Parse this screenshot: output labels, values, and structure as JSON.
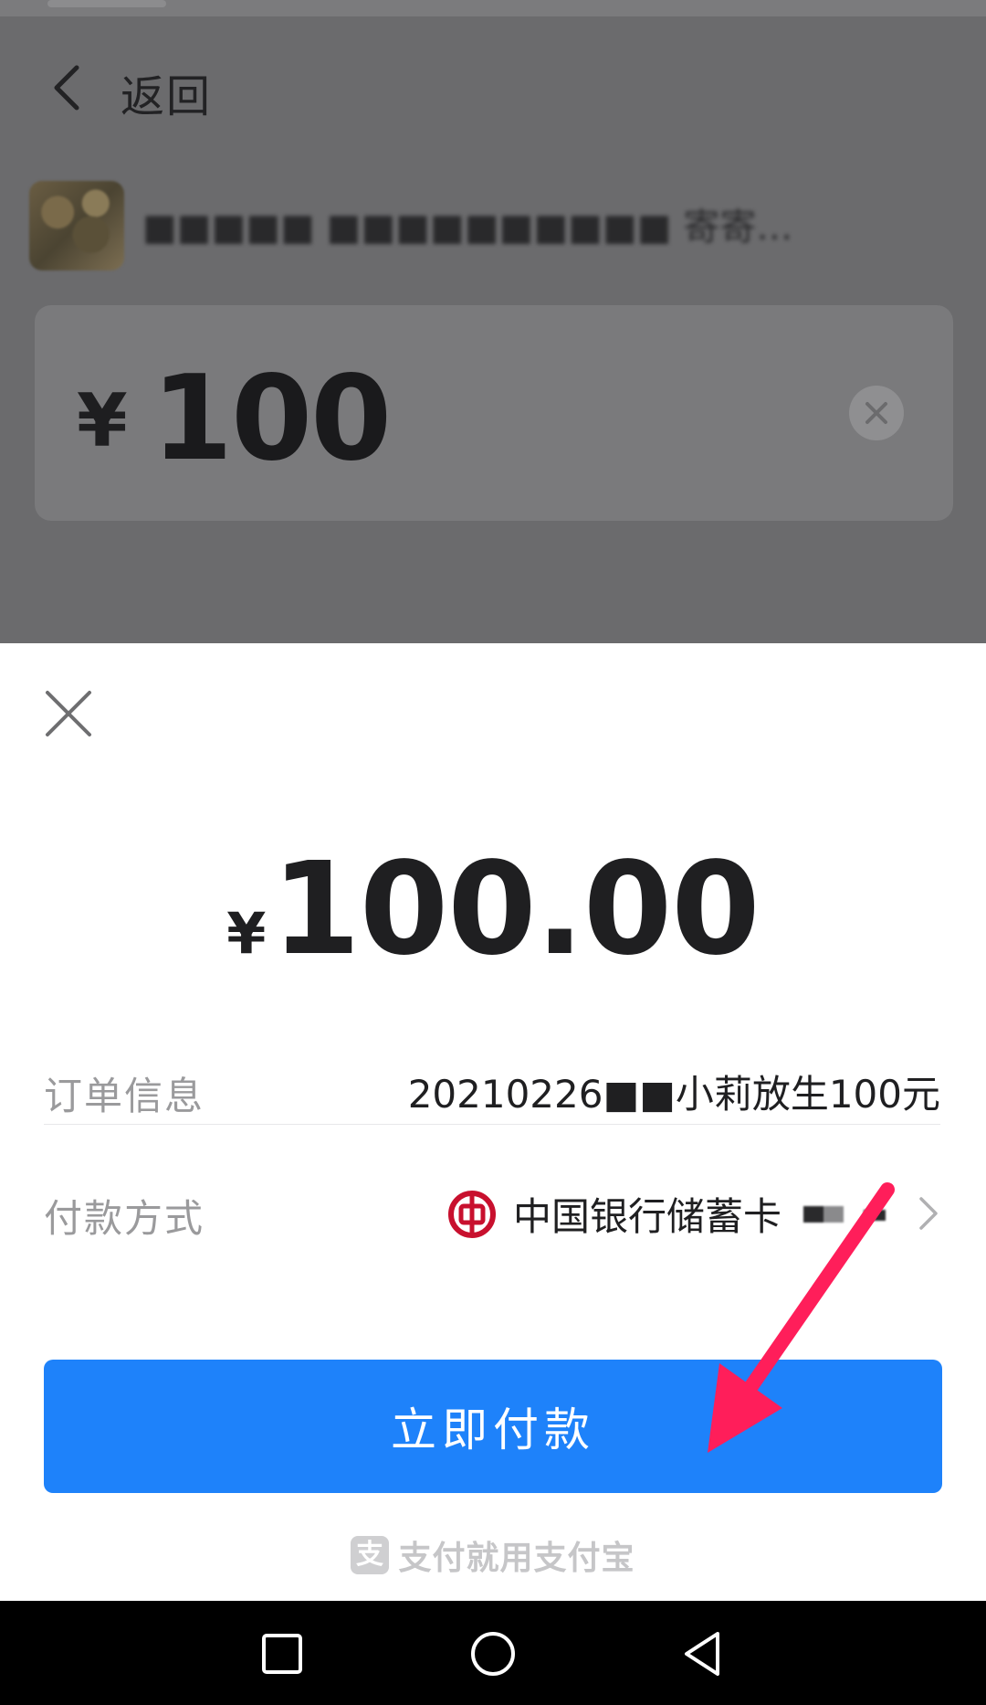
{
  "background_page": {
    "back_label": "返回",
    "payee_name": "■■■■■ ■■■■■■■■■■ 寄寄…",
    "amount_currency": "¥",
    "amount_value": "100"
  },
  "payment_sheet": {
    "currency": "¥",
    "total": "100.00",
    "order_info": {
      "label": "订单信息",
      "value": "20210226■■小莉放生100元"
    },
    "payment_method": {
      "label": "付款方式",
      "bank_name": "中国银行储蓄卡",
      "bank_icon": "bank-of-china-icon"
    },
    "pay_button_label": "立即付款",
    "footer_brand": "支付就用支付宝",
    "footer_logo_char": "支"
  },
  "colors": {
    "primary_button": "#1e82fa",
    "overlay": "#6b6b6d",
    "bank_red": "#c8102e",
    "annotation_arrow": "#ff1e5a"
  },
  "system_nav": {
    "icons": [
      "recent-apps-icon",
      "home-icon",
      "back-icon"
    ]
  }
}
